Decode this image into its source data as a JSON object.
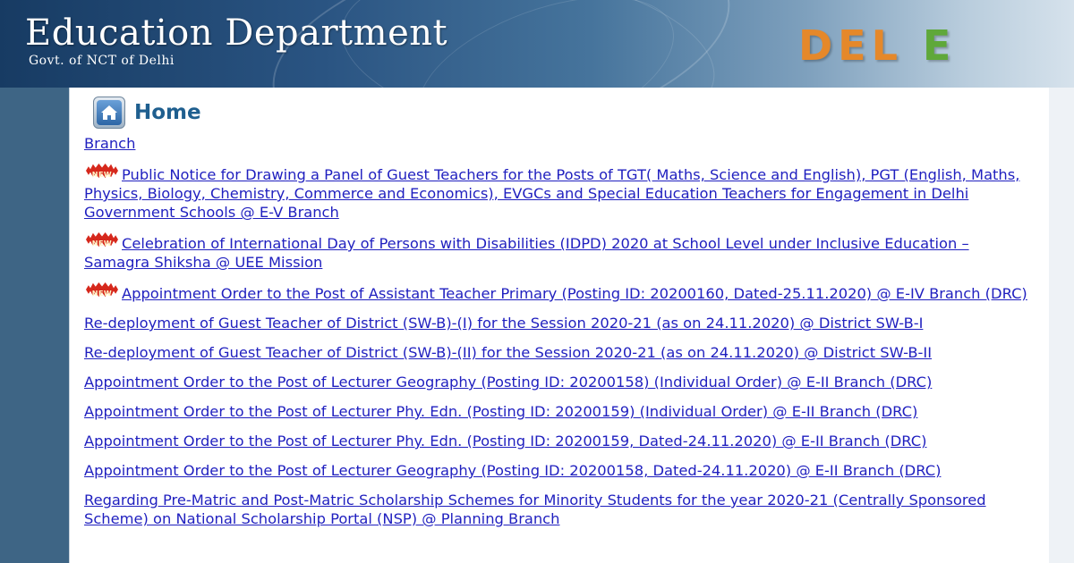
{
  "header": {
    "title": "Education Department",
    "subtitle": "Govt. of NCT of Delhi",
    "logo_left": "DEL",
    "logo_right": "E"
  },
  "page": {
    "title": "Home",
    "home_icon": "home-icon"
  },
  "colors": {
    "link": "#1f1fbf",
    "title": "#1f5f8f",
    "badge": "#d6281c",
    "logo_orange": "#e5882a",
    "logo_green": "#5fa83a"
  },
  "badge_text": "NEW",
  "notices": [
    {
      "text": "Branch",
      "new": false
    },
    {
      "text": "Public Notice for Drawing a Panel of Guest Teachers for the Posts of TGT( Maths, Science and English), PGT (English, Maths, Physics, Biology, Chemistry, Commerce and Economics), EVGCs and Special Education Teachers for Engagement in Delhi Government Schools @ E-V Branch",
      "new": true
    },
    {
      "text": "Celebration of International Day of Persons with Disabilities (IDPD) 2020 at School Level under Inclusive Education – Samagra Shiksha @ UEE Mission",
      "new": true
    },
    {
      "text": "Appointment Order to the Post of Assistant Teacher Primary (Posting ID: 20200160, Dated-25.11.2020) @ E-IV Branch (DRC)",
      "new": true
    },
    {
      "text": "Re-deployment of Guest Teacher of District (SW-B)-(I) for the Session 2020-21 (as on 24.11.2020) @ District SW-B-I",
      "new": false
    },
    {
      "text": "Re-deployment of Guest Teacher of District (SW-B)-(II) for the Session 2020-21 (as on 24.11.2020) @ District SW-B-II",
      "new": false
    },
    {
      "text": "Appointment Order to the Post of Lecturer Geography (Posting ID: 20200158) (Individual Order) @ E-II Branch (DRC)",
      "new": false
    },
    {
      "text": "Appointment Order to the Post of Lecturer Phy. Edn. (Posting ID: 20200159) (Individual Order) @ E-II Branch (DRC)",
      "new": false
    },
    {
      "text": "Appointment Order to the Post of Lecturer Phy. Edn. (Posting ID: 20200159, Dated-24.11.2020) @ E-II Branch (DRC)",
      "new": false
    },
    {
      "text": "Appointment Order to the Post of Lecturer Geography (Posting ID: 20200158, Dated-24.11.2020) @ E-II Branch (DRC)",
      "new": false
    },
    {
      "text": "Regarding Pre-Matric and Post-Matric Scholarship Schemes for Minority Students for the year 2020-21 (Centrally Sponsored Scheme) on National Scholarship Portal (NSP) @ Planning Branch",
      "new": false
    }
  ]
}
